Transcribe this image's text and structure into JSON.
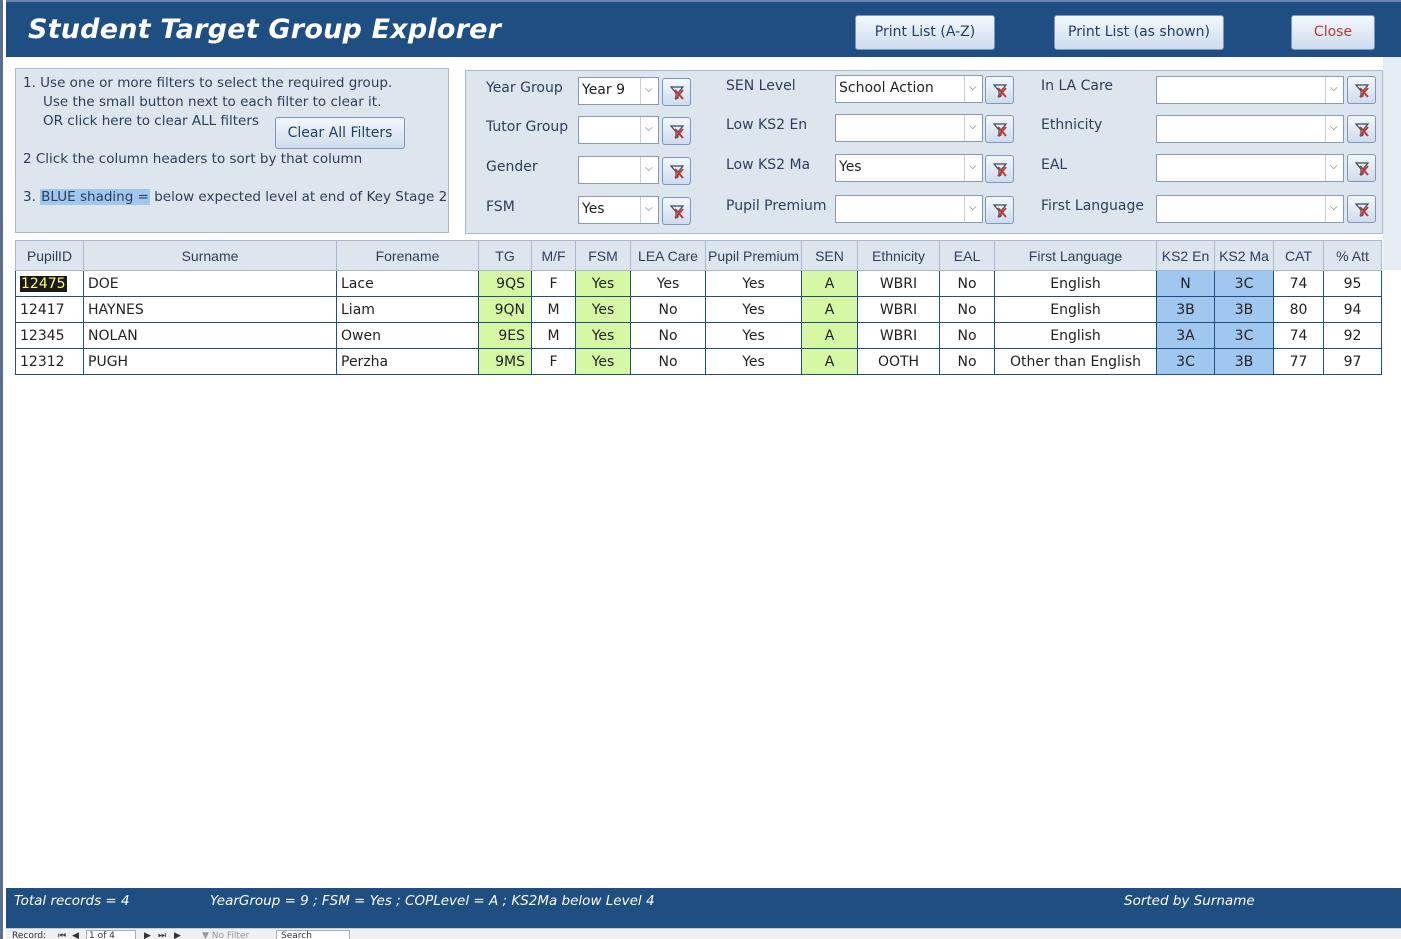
{
  "header": {
    "title": "Student Target Group Explorer",
    "print_az": "Print List (A-Z)",
    "print_shown": "Print List (as shown)",
    "close": "Close"
  },
  "instructions": {
    "line1": "1.  Use one or more filters to select the required group.",
    "line2": "Use the small button next to each filter to clear it.",
    "line3": "OR click here to clear ALL filters",
    "clear_all": "Clear All Filters",
    "line4": "2   Click the column headers to sort by that column",
    "line5_prefix": "3.  ",
    "line5_highlight": "BLUE shading =",
    "line5_suffix": " below expected level at end of Key Stage 2"
  },
  "filters": {
    "year_group": {
      "label": "Year Group",
      "value": "Year 9"
    },
    "tutor_group": {
      "label": "Tutor Group",
      "value": ""
    },
    "gender": {
      "label": "Gender",
      "value": ""
    },
    "fsm": {
      "label": "FSM",
      "value": "Yes"
    },
    "sen_level": {
      "label": "SEN Level",
      "value": "School Action"
    },
    "low_ks2_en": {
      "label": "Low KS2 En",
      "value": ""
    },
    "low_ks2_ma": {
      "label": "Low KS2 Ma",
      "value": "Yes"
    },
    "pupil_premium": {
      "label": "Pupil Premium",
      "value": ""
    },
    "in_la_care": {
      "label": "In LA Care",
      "value": ""
    },
    "ethnicity": {
      "label": "Ethnicity",
      "value": ""
    },
    "eal": {
      "label": "EAL",
      "value": ""
    },
    "first_language": {
      "label": "First Language",
      "value": ""
    }
  },
  "table": {
    "columns": [
      "PupilID",
      "Surname",
      "Forename",
      "TG",
      "M/F",
      "FSM",
      "LEA Care",
      "Pupil Premium",
      "SEN",
      "Ethnicity",
      "EAL",
      "First Language",
      "KS2 En",
      "KS2 Ma",
      "CAT",
      "% Att"
    ],
    "rows": [
      [
        "12475",
        "DOE",
        "Lace",
        "9QS",
        "F",
        "Yes",
        "Yes",
        "Yes",
        "A",
        "WBRI",
        "No",
        "English",
        "N",
        "3C",
        "74",
        "95"
      ],
      [
        "12417",
        "HAYNES",
        "Liam",
        "9QN",
        "M",
        "Yes",
        "No",
        "Yes",
        "A",
        "WBRI",
        "No",
        "English",
        "3B",
        "3B",
        "80",
        "94"
      ],
      [
        "12345",
        "NOLAN",
        "Owen",
        "9ES",
        "M",
        "Yes",
        "No",
        "Yes",
        "A",
        "WBRI",
        "No",
        "English",
        "3A",
        "3C",
        "74",
        "92"
      ],
      [
        "12312",
        "PUGH",
        "Perzha",
        "9MS",
        "F",
        "Yes",
        "No",
        "Yes",
        "A",
        "OOTH",
        "No",
        "Other than English",
        "3C",
        "3B",
        "77",
        "97"
      ]
    ]
  },
  "footer": {
    "total": "Total records = 4",
    "criteria": "YearGroup = 9 ; FSM = Yes ; COPLevel = A ; KS2Ma below Level 4",
    "sorted": "Sorted by Surname"
  },
  "navbar": {
    "record_label": "Record:",
    "record_pos": "1 of 4",
    "no_filter": "No Filter",
    "search": "Search"
  },
  "colors": {
    "header_bg": "#1f4e82",
    "panel_bg": "#dde5ef",
    "green_cell": "#d6f7a3",
    "blue_cell": "#9fc7ef",
    "close_text": "#c0392b"
  }
}
